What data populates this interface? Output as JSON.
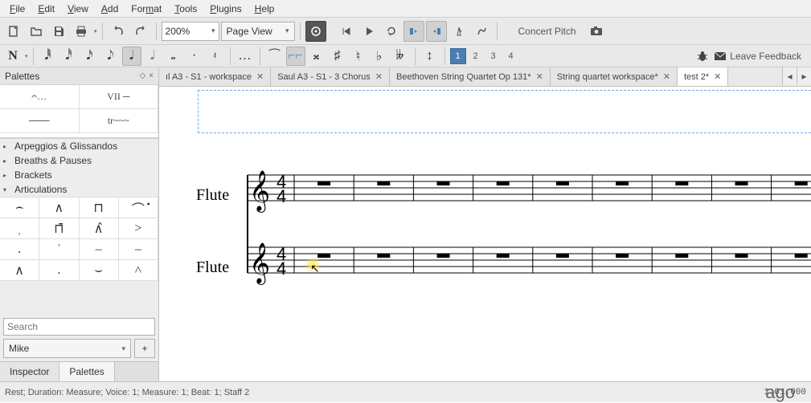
{
  "menu": [
    "File",
    "Edit",
    "View",
    "Add",
    "Format",
    "Tools",
    "Plugins",
    "Help"
  ],
  "menu_underline": [
    0,
    0,
    0,
    0,
    3,
    0,
    0,
    0
  ],
  "toolbar": {
    "zoom": "200%",
    "view_mode": "Page View",
    "concert_pitch": "Concert Pitch"
  },
  "voices": [
    "1",
    "2",
    "3",
    "4"
  ],
  "selected_voice": 0,
  "feedback": {
    "bug": "",
    "leave": "Leave Feedback"
  },
  "sidebar": {
    "title": "Palettes",
    "top_cells_row1": [
      "𝄐…",
      "VII ─"
    ],
    "top_cells_row2": [
      "───",
      "tr~~~"
    ],
    "categories": [
      {
        "label": "Arpeggios & Glissandos",
        "open": false
      },
      {
        "label": "Breaths & Pauses",
        "open": false
      },
      {
        "label": "Brackets",
        "open": false
      },
      {
        "label": "Articulations",
        "open": true
      }
    ],
    "articulations": [
      [
        "⌢",
        "∧",
        "⊓",
        "⌒̇"
      ],
      [
        "ˌ",
        "⊓̄",
        "∧̂",
        ">"
      ],
      [
        ".",
        "ˈ",
        "–",
        "–"
      ],
      [
        "∧",
        ".",
        "⌣",
        "˄"
      ]
    ],
    "search_placeholder": "Search",
    "workspace": "Mike",
    "tabs": [
      "Inspector",
      "Palettes"
    ],
    "active_tab": 1
  },
  "tabs": [
    {
      "label": "ıl A3 - S1 - workspace",
      "active": false
    },
    {
      "label": "Saul A3 - S1 - 3 Chorus",
      "active": false
    },
    {
      "label": "Beethoven String Quartet Op 131*",
      "active": false
    },
    {
      "label": "String quartet workspace*",
      "active": false
    },
    {
      "label": "test 2*",
      "active": true
    }
  ],
  "score": {
    "instruments": [
      "Flute",
      "Flute"
    ],
    "measures_per_line": 10,
    "rest_glyph": "━"
  },
  "status": {
    "left": "Rest; Duration: Measure; Voice: 1;  Measure: 1; Beat: 1; Staff 2",
    "right": "1:01:000"
  },
  "extra_caption": "ago"
}
